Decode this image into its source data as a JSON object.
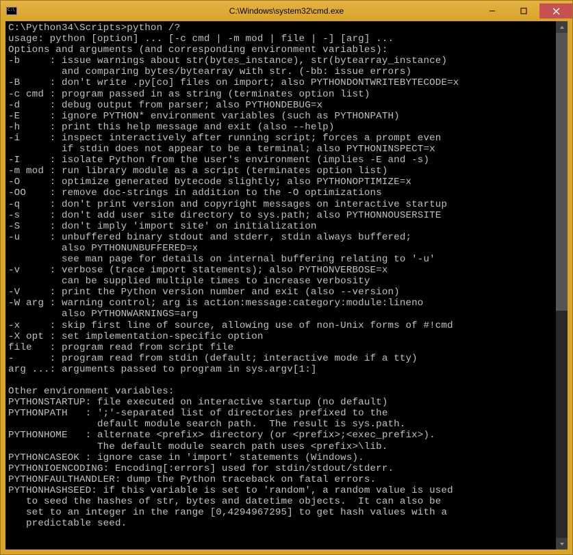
{
  "title": "C:\\Windows\\system32\\cmd.exe",
  "terminal_lines": [
    "C:\\Python34\\Scripts>python /?",
    "usage: python [option] ... [-c cmd | -m mod | file | -] [arg] ...",
    "Options and arguments (and corresponding environment variables):",
    "-b     : issue warnings about str(bytes_instance), str(bytearray_instance)",
    "         and comparing bytes/bytearray with str. (-bb: issue errors)",
    "-B     : don't write .py[co] files on import; also PYTHONDONTWRITEBYTECODE=x",
    "-c cmd : program passed in as string (terminates option list)",
    "-d     : debug output from parser; also PYTHONDEBUG=x",
    "-E     : ignore PYTHON* environment variables (such as PYTHONPATH)",
    "-h     : print this help message and exit (also --help)",
    "-i     : inspect interactively after running script; forces a prompt even",
    "         if stdin does not appear to be a terminal; also PYTHONINSPECT=x",
    "-I     : isolate Python from the user's environment (implies -E and -s)",
    "-m mod : run library module as a script (terminates option list)",
    "-O     : optimize generated bytecode slightly; also PYTHONOPTIMIZE=x",
    "-OO    : remove doc-strings in addition to the -O optimizations",
    "-q     : don't print version and copyright messages on interactive startup",
    "-s     : don't add user site directory to sys.path; also PYTHONNOUSERSITE",
    "-S     : don't imply 'import site' on initialization",
    "-u     : unbuffered binary stdout and stderr, stdin always buffered;",
    "         also PYTHONUNBUFFERED=x",
    "         see man page for details on internal buffering relating to '-u'",
    "-v     : verbose (trace import statements); also PYTHONVERBOSE=x",
    "         can be supplied multiple times to increase verbosity",
    "-V     : print the Python version number and exit (also --version)",
    "-W arg : warning control; arg is action:message:category:module:lineno",
    "         also PYTHONWARNINGS=arg",
    "-x     : skip first line of source, allowing use of non-Unix forms of #!cmd",
    "-X opt : set implementation-specific option",
    "file   : program read from script file",
    "-      : program read from stdin (default; interactive mode if a tty)",
    "arg ...: arguments passed to program in sys.argv[1:]",
    "",
    "Other environment variables:",
    "PYTHONSTARTUP: file executed on interactive startup (no default)",
    "PYTHONPATH   : ';'-separated list of directories prefixed to the",
    "               default module search path.  The result is sys.path.",
    "PYTHONHOME   : alternate <prefix> directory (or <prefix>;<exec_prefix>).",
    "               The default module search path uses <prefix>\\lib.",
    "PYTHONCASEOK : ignore case in 'import' statements (Windows).",
    "PYTHONIOENCODING: Encoding[:errors] used for stdin/stdout/stderr.",
    "PYTHONFAULTHANDLER: dump the Python traceback on fatal errors.",
    "PYTHONHASHSEED: if this variable is set to 'random', a random value is used",
    "   to seed the hashes of str, bytes and datetime objects.  It can also be",
    "   set to an integer in the range [0,4294967295] to get hash values with a",
    "   predictable seed."
  ]
}
